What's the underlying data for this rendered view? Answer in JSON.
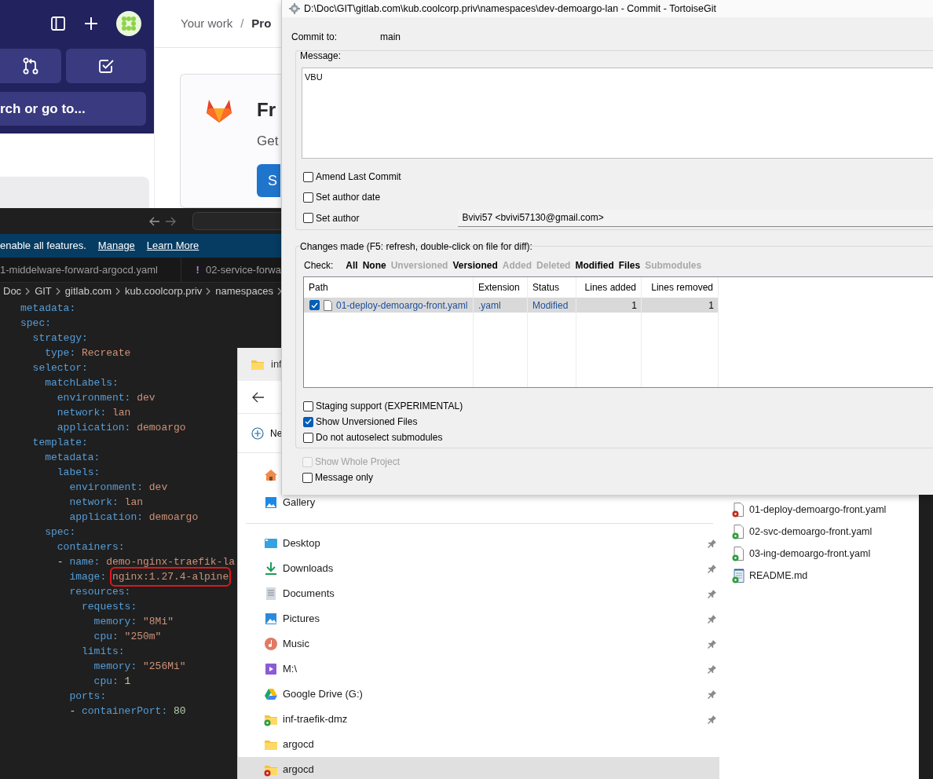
{
  "gitlab": {
    "search_text": "rch or go to...",
    "breadcrumb": [
      {
        "label": "Your work",
        "current": false
      },
      {
        "label": "Pro",
        "current": true
      }
    ],
    "separator": "/",
    "promo": {
      "title": "Fr",
      "text": "Get",
      "button": "S"
    }
  },
  "editor": {
    "notification": {
      "text": "enable all features.",
      "links": [
        "Manage",
        "Learn More"
      ]
    },
    "tabs": [
      {
        "label": "1-middelware-forward-argocd.yaml"
      },
      {
        "badge": "!",
        "label": "02-service-forwa"
      }
    ],
    "breadcrumb": [
      "Doc",
      "GIT",
      "gitlab.com",
      "kub.coolcorp.priv",
      "namespaces"
    ],
    "code": [
      {
        "key": "metadata:"
      },
      {
        "key": "spec:",
        "children": [
          {
            "key": "strategy:",
            "children": [
              {
                "key": "type:",
                "value": "Recreate"
              }
            ]
          },
          {
            "key": "selector:",
            "children": [
              {
                "key": "matchLabels:",
                "children": [
                  {
                    "key": "environment:",
                    "value": "dev"
                  },
                  {
                    "key": "network:",
                    "value": "lan"
                  },
                  {
                    "key": "application:",
                    "value": "demoargo"
                  }
                ]
              }
            ]
          },
          {
            "key": "template:",
            "children": [
              {
                "key": "metadata:",
                "children": [
                  {
                    "key": "labels:",
                    "children": [
                      {
                        "key": "environment:",
                        "value": "dev"
                      },
                      {
                        "key": "network:",
                        "value": "lan"
                      },
                      {
                        "key": "application:",
                        "value": "demoargo"
                      }
                    ]
                  }
                ]
              },
              {
                "key": "spec:",
                "children": [
                  {
                    "key": "containers:",
                    "children": [
                      {
                        "marker": "-",
                        "fields": [
                          {
                            "key": "name:",
                            "value": "demo-nginx-traefik-la"
                          },
                          {
                            "key": "image:",
                            "value": "nginx:1.27.4-alpine",
                            "highlighted": true
                          },
                          {
                            "key": "resources:",
                            "children": [
                              {
                                "key": "requests:",
                                "children": [
                                  {
                                    "key": "memory:",
                                    "value": "\"8Mi\""
                                  },
                                  {
                                    "key": "cpu:",
                                    "value": "\"250m\""
                                  }
                                ]
                              },
                              {
                                "key": "limits:",
                                "children": [
                                  {
                                    "key": "memory:",
                                    "value": "\"256Mi\""
                                  },
                                  {
                                    "key": "cpu:",
                                    "value": "1",
                                    "kind": "number"
                                  }
                                ]
                              }
                            ]
                          },
                          {
                            "key": "ports:",
                            "children": [
                              {
                                "marker": "-",
                                "fields": [
                                  {
                                    "key": "containerPort:",
                                    "value": "80",
                                    "kind": "number"
                                  }
                                ]
                              }
                            ]
                          }
                        ]
                      }
                    ]
                  }
                ]
              }
            ]
          }
        ]
      }
    ]
  },
  "commit_dialog": {
    "title": "D:\\Doc\\GIT\\gitlab.com\\kub.coolcorp.priv\\namespaces\\dev-demoargo-lan - Commit - TortoiseGit",
    "commit_to_label": "Commit to:",
    "branch": "main",
    "message_label": "Message:",
    "message": "VBU",
    "commit_options": [
      {
        "label": "Amend Last Commit",
        "checked": false
      },
      {
        "label": "Set author date",
        "checked": false
      },
      {
        "label": "Set author",
        "checked": false
      }
    ],
    "author": "Bvivi57 <bvivi57130@gmail.com>",
    "changes_label": "Changes made (F5: refresh, double-click on file for diff):",
    "check_label": "Check:",
    "check_filters": [
      {
        "label": "All",
        "enabled": true
      },
      {
        "label": "None",
        "enabled": true
      },
      {
        "label": "Unversioned",
        "enabled": false
      },
      {
        "label": "Versioned",
        "enabled": true
      },
      {
        "label": "Added",
        "enabled": false
      },
      {
        "label": "Deleted",
        "enabled": false
      },
      {
        "label": "Modified",
        "enabled": true
      },
      {
        "label": "Files",
        "enabled": true
      },
      {
        "label": "Submodules",
        "enabled": false
      }
    ],
    "columns": [
      "Path",
      "Extension",
      "Status",
      "Lines added",
      "Lines removed"
    ],
    "files": [
      {
        "checked": true,
        "selected": true,
        "path": "01-deploy-demoargo-front.yaml",
        "extension": ".yaml",
        "status": "Modified",
        "lines_added": "1",
        "lines_removed": "1"
      }
    ],
    "list_options": [
      {
        "label": "Staging support (EXPERIMENTAL)",
        "checked": false
      },
      {
        "label": "Show Unversioned Files",
        "checked": true
      },
      {
        "label": "Do not autoselect submodules",
        "checked": false
      }
    ],
    "bottom_options": [
      {
        "label": "Show Whole Project",
        "checked": false,
        "disabled": true
      },
      {
        "label": "Message only",
        "checked": false,
        "disabled": false
      }
    ]
  },
  "explorer": {
    "tab_title": "inf",
    "new_button": "Ne",
    "quick_access": [
      {
        "kind": "home"
      },
      {
        "kind": "gallery",
        "label": "Gallery"
      }
    ],
    "nav_items": [
      {
        "kind": "desktop",
        "label": "Desktop",
        "pinned": true,
        "selected": false
      },
      {
        "kind": "downloads",
        "label": "Downloads",
        "pinned": true,
        "selected": false
      },
      {
        "kind": "documents",
        "label": "Documents",
        "pinned": true,
        "selected": false
      },
      {
        "kind": "pictures",
        "label": "Pictures",
        "pinned": true,
        "selected": false
      },
      {
        "kind": "music",
        "label": "Music",
        "pinned": true,
        "selected": false
      },
      {
        "kind": "video",
        "label": "M:\\",
        "pinned": true,
        "selected": false
      },
      {
        "kind": "drive",
        "label": "Google Drive (G:)",
        "pinned": true,
        "selected": false
      },
      {
        "kind": "folder",
        "label": "inf-traefik-dmz",
        "pinned": true,
        "color": "#2f9e3a",
        "selected": false
      },
      {
        "kind": "folder",
        "label": "argocd",
        "pinned": false,
        "selected": false
      },
      {
        "kind": "folder",
        "label": "argocd",
        "pinned": false,
        "color": "#c4281c",
        "selected": true
      }
    ],
    "files": [
      {
        "kind": "yaml",
        "name": "01-deploy-demoargo-front.yaml",
        "color": "#c4281c"
      },
      {
        "kind": "yaml",
        "name": "02-svc-demoargo-front.yaml",
        "color": "#2f9e3a"
      },
      {
        "kind": "yaml",
        "name": "03-ing-demoargo-front.yaml",
        "color": "#2f9e3a"
      },
      {
        "kind": "text",
        "name": "README.md",
        "color": "#2f9e3a"
      }
    ]
  }
}
